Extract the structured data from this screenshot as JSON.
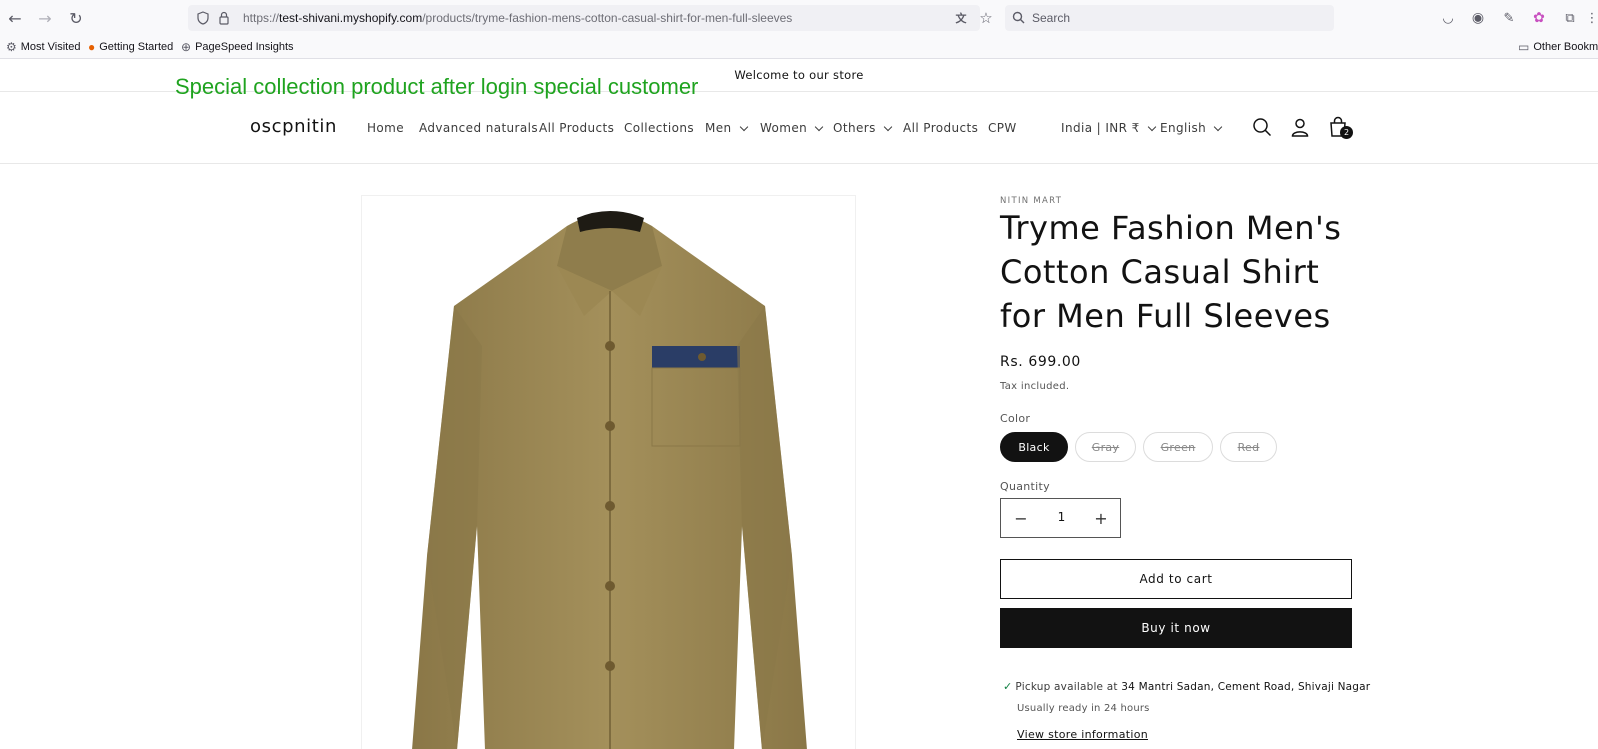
{
  "browser": {
    "url_prefix": "https://",
    "url_host": "test-shivani.myshopify.com",
    "url_path": "/products/tryme-fashion-mens-cotton-casual-shirt-for-men-full-sleeves",
    "search_placeholder": "Search",
    "bookmarks": [
      "Most Visited",
      "Getting Started",
      "PageSpeed Insights"
    ],
    "other_bookmarks": "Other Bookma"
  },
  "overlay_caption": "Special collection product after login special customer",
  "store": {
    "announcement": "Welcome to our store",
    "logo": "oscpnitin",
    "nav": [
      {
        "label": "Home",
        "dropdown": false
      },
      {
        "label": "Advanced naturals",
        "dropdown": false
      },
      {
        "label": "All Products",
        "dropdown": false
      },
      {
        "label": "Collections",
        "dropdown": false
      },
      {
        "label": "Men",
        "dropdown": true
      },
      {
        "label": "Women",
        "dropdown": true
      },
      {
        "label": "Others",
        "dropdown": true
      },
      {
        "label": "All Products",
        "dropdown": false
      },
      {
        "label": "CPW",
        "dropdown": false
      }
    ],
    "country": "India | INR ₹",
    "language": "English",
    "cart_count": "2"
  },
  "product": {
    "vendor": "NITIN MART",
    "title": "Tryme Fashion Men's Cotton Casual Shirt for Men Full Sleeves",
    "price": "Rs. 699.00",
    "tax_note": "Tax included.",
    "color_label": "Color",
    "colors": [
      {
        "name": "Black",
        "selected": true,
        "available": true
      },
      {
        "name": "Gray",
        "selected": false,
        "available": false
      },
      {
        "name": "Green",
        "selected": false,
        "available": false
      },
      {
        "name": "Red",
        "selected": false,
        "available": false
      }
    ],
    "quantity_label": "Quantity",
    "quantity": "1",
    "qty_minus": "−",
    "qty_plus": "+",
    "add_to_cart": "Add to cart",
    "buy_now": "Buy it now",
    "pickup_prefix": "Pickup available at",
    "pickup_address": "34 Mantri Sadan, Cement Road, Shivaji Nagar",
    "ready_text": "Usually ready in 24 hours",
    "store_info_link": "View store information",
    "image_color": "#a4905b",
    "pocket_color": "#2a3d66"
  }
}
